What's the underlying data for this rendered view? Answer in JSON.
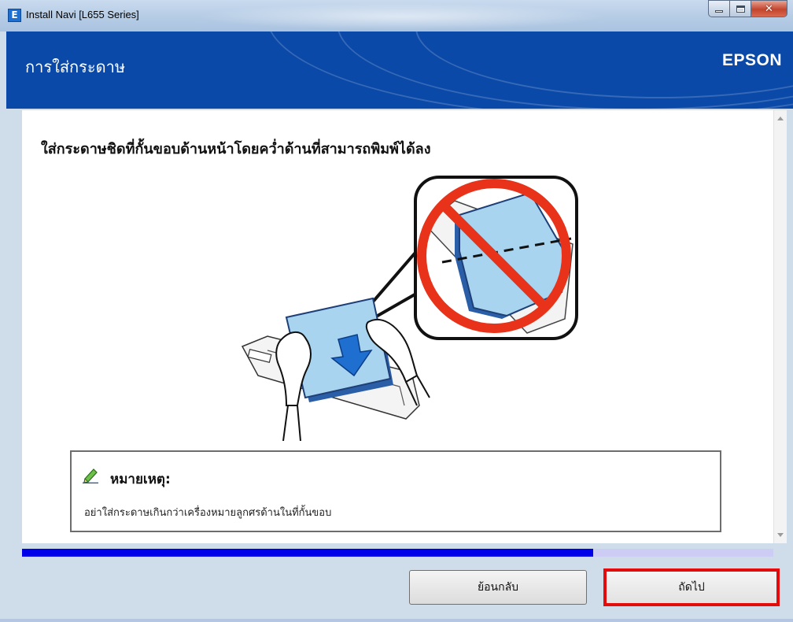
{
  "window": {
    "title": "Install Navi [L655 Series]",
    "app_icon_letter": "E"
  },
  "header": {
    "title": "การใส่กระดาษ",
    "brand": "EPSON",
    "background": "#0a49a8"
  },
  "content": {
    "instruction": "ใส่กระดาษชิดที่กั้นขอบด้านหน้าโดยคว่ำด้านที่สามารถพิมพ์ได้ลง"
  },
  "note": {
    "title": "หมายเหตุ:",
    "text": "อย่าใส่กระดาษเกินกว่าเครื่องหมายลูกศรด้านในที่กั้นขอบ",
    "icon": "pencil-icon"
  },
  "progress": {
    "fraction": 0.76,
    "fill_color": "#0000e8",
    "track_color": "#ccccf4"
  },
  "buttons": {
    "back_label": "ย้อนกลับ",
    "next_label": "ถัดไป",
    "highlight_color": "#e30b0b"
  }
}
